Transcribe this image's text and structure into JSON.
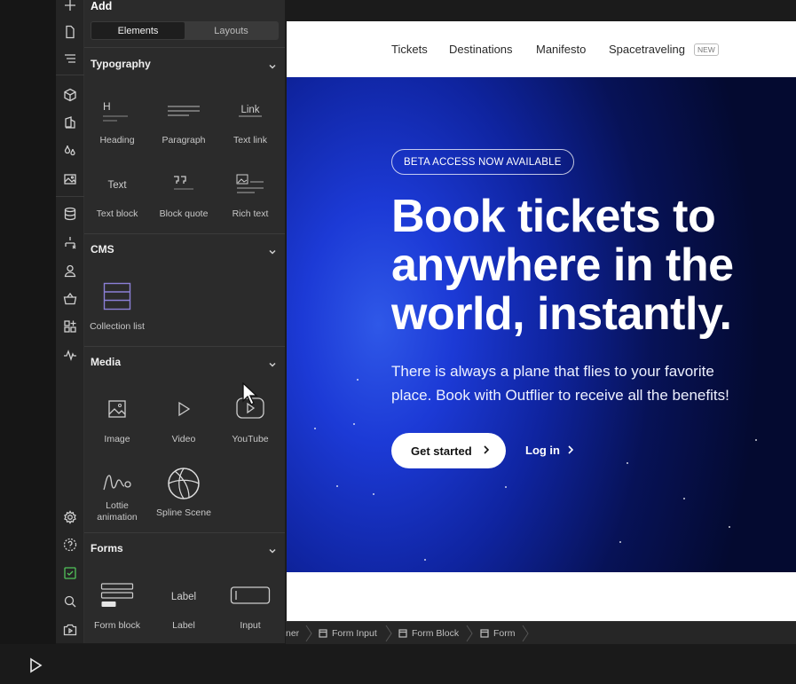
{
  "panel": {
    "title": "Add",
    "tabs": [
      "Elements",
      "Layouts"
    ],
    "active_tab": "Elements",
    "sections": {
      "typography": {
        "title": "Typography",
        "items": [
          "Heading",
          "Paragraph",
          "Text link",
          "Text block",
          "Block quote",
          "Rich text"
        ],
        "heading_glyph": "H",
        "link_glyph": "Link",
        "text_glyph": "Text"
      },
      "cms": {
        "title": "CMS",
        "items": [
          "Collection list"
        ]
      },
      "media": {
        "title": "Media",
        "items": [
          "Image",
          "Video",
          "YouTube",
          "Lottie animation",
          "Spline Scene"
        ]
      },
      "forms": {
        "title": "Forms",
        "items": [
          "Form block",
          "Label",
          "Input"
        ],
        "label_glyph": "Label"
      }
    }
  },
  "rail_icons": [
    "plus-icon",
    "page-icon",
    "navigator-icon",
    "components-icon",
    "style-icon",
    "color-icon",
    "assets-icon",
    "cms-icon",
    "logic-icon",
    "users-icon",
    "ecommerce-icon",
    "apps-icon",
    "audit-icon",
    "settings-icon",
    "help-icon",
    "checklist-icon",
    "search-icon",
    "video-tutorial-icon"
  ],
  "site": {
    "nav": {
      "links": [
        "Tickets",
        "Destinations",
        "Manifesto",
        "Spacetraveling"
      ],
      "badge": "NEW"
    },
    "hero": {
      "badge": "BETA ACCESS NOW AVAILABLE",
      "headline_lines": [
        "Book tickets to",
        "anywhere in the",
        "world, instantly."
      ],
      "subtext_lines": [
        "There is always a plane that flies to your favorite",
        "place. Book with Outflier to receive all the benefits!"
      ],
      "cta_primary": "Get started",
      "cta_secondary": "Log in"
    }
  },
  "breadcrumb": [
    "ner",
    "Form Input",
    "Form Block",
    "Form"
  ],
  "colors": {
    "hero_center": "#2f58e8",
    "hero_edge": "#040a30",
    "panel_bg": "#2b2b2b",
    "cms_accent": "#8b7fd6"
  }
}
